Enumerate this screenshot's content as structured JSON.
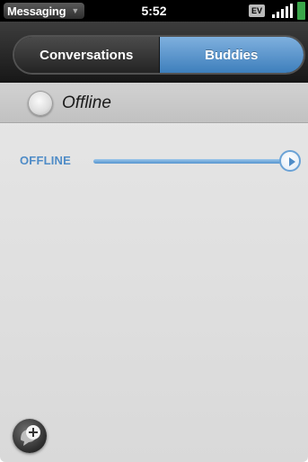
{
  "status_bar": {
    "app_name": "Messaging",
    "time": "5:52",
    "carrier": "EV",
    "battery_color": "#3aa64a"
  },
  "tabs": [
    {
      "label": "Conversations",
      "selected": false
    },
    {
      "label": "Buddies",
      "selected": true
    }
  ],
  "my_status": {
    "label": "Offline",
    "icon": "presence-offline-icon"
  },
  "groups": [
    {
      "label": "OFFLINE",
      "expand_icon": "play-arrow-icon",
      "color": "#4f8cc7"
    }
  ],
  "actions": {
    "new_chat_icon": "new-message-icon"
  },
  "colors": {
    "accent": "#4f8cc7",
    "tab_selected": "#5a93cc",
    "header": "#1d1d1d"
  }
}
